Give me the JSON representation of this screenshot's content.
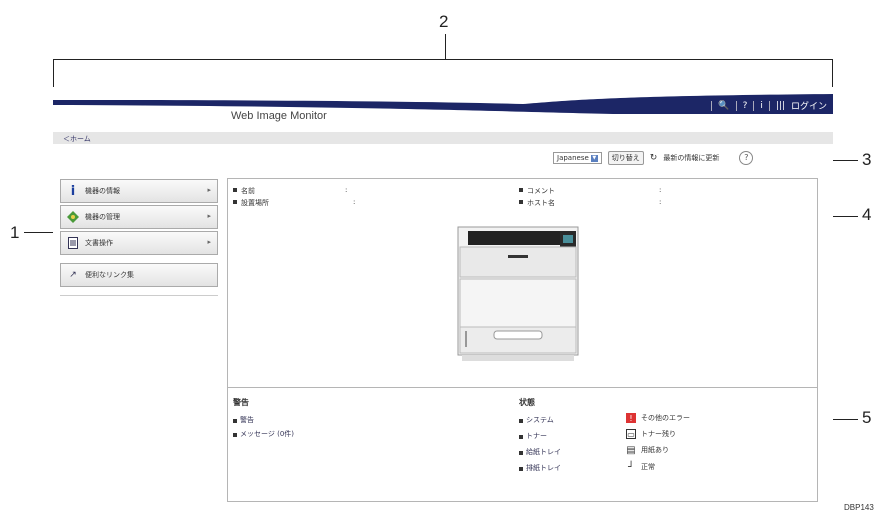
{
  "callouts": [
    "1",
    "2",
    "3",
    "4",
    "5"
  ],
  "footer_code": "DBP143",
  "header": {
    "app_title": "Web Image Monitor",
    "tools": [
      "🔍",
      "?",
      "i",
      "|||",
      "ログイン"
    ]
  },
  "home_link": "＜ホーム",
  "toolbar": {
    "language_value": "Japanese",
    "switch_button": "切り替え",
    "refresh_button": "最新の情報に更新",
    "help": "?"
  },
  "sidebar": {
    "items": [
      {
        "label": "機器の情報",
        "icon": "info-icon"
      },
      {
        "label": "機器の管理",
        "icon": "device-management-icon"
      },
      {
        "label": "文書操作",
        "icon": "document-icon"
      }
    ],
    "links_label": "便利なリンク集"
  },
  "device_info": {
    "name_label": "名前",
    "name_value": ":",
    "location_label": "設置場所",
    "location_value": ":",
    "comment_label": "コメント",
    "comment_value": ":",
    "host_label": "ホスト名",
    "host_value": ":"
  },
  "alerts": {
    "title": "警告",
    "items": [
      "警告",
      "メッセージ (0件)"
    ]
  },
  "status": {
    "title": "状態",
    "items": [
      "システム",
      "トナー",
      "給紙トレイ",
      "排紙トレイ"
    ],
    "legend": [
      "その他のエラー",
      "トナー残り",
      "用紙あり",
      "正常"
    ]
  },
  "colors": {
    "header_navy": "#1c2666",
    "border": "#b5b5b5"
  }
}
